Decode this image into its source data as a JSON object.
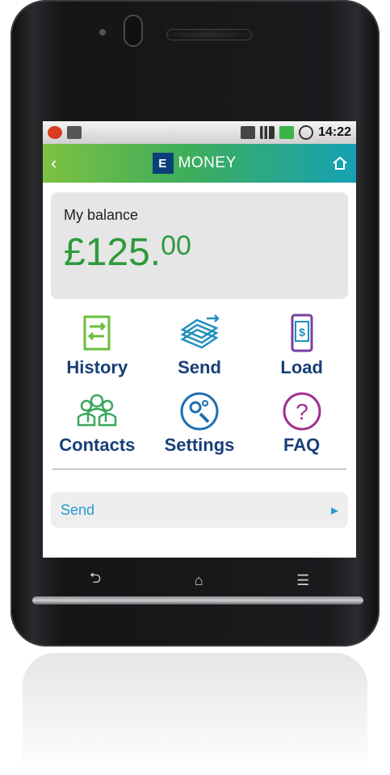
{
  "status_bar": {
    "time": "14:22"
  },
  "header": {
    "title": "MONEY",
    "logo_text": "E",
    "back_icon": "back-chevron-icon",
    "home_icon": "home-icon"
  },
  "balance": {
    "label": "My balance",
    "amount_main": "£125.",
    "amount_decimal": "00"
  },
  "tiles": [
    {
      "label": "History",
      "icon": "history-icon",
      "color": "#6cbf3a"
    },
    {
      "label": "Send",
      "icon": "send-money-icon",
      "color": "#1f8fbf"
    },
    {
      "label": "Load",
      "icon": "load-phone-icon",
      "color": "#7a3fa0"
    },
    {
      "label": "Contacts",
      "icon": "contacts-icon",
      "color": "#3aa65a"
    },
    {
      "label": "Settings",
      "icon": "settings-icon",
      "color": "#1f6fb0"
    },
    {
      "label": "FAQ",
      "icon": "faq-icon",
      "color": "#a0308f"
    }
  ],
  "list": {
    "send_label": "Send"
  },
  "colors": {
    "brand_green": "#2e9a3c",
    "label_navy": "#173f78",
    "header_start": "#7dc143",
    "header_end": "#16a1b4"
  }
}
